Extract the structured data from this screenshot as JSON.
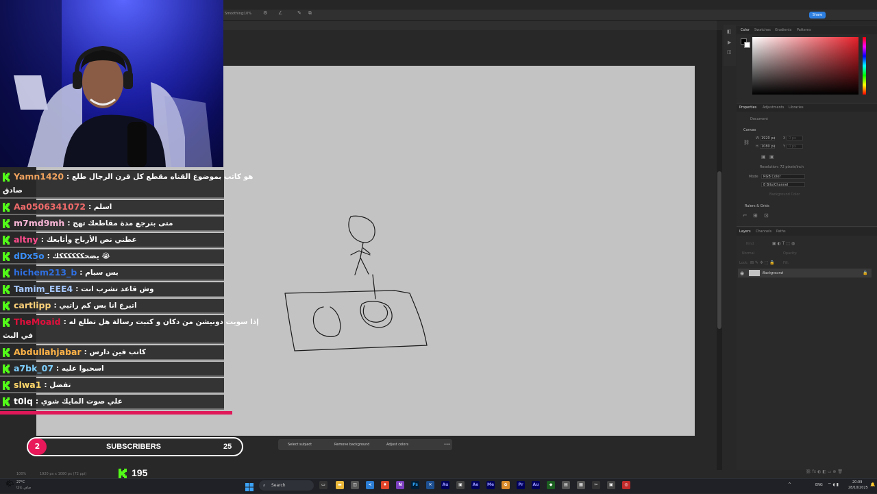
{
  "photoshop": {
    "options_bar": {
      "smoothing_label": "Smoothing:",
      "smoothing_value": "10%",
      "share_label": "Share"
    },
    "color_panel": {
      "tabs": [
        "Color",
        "Swatches",
        "Gradients",
        "Patterns"
      ]
    },
    "properties_panel": {
      "tabs": [
        "Properties",
        "Adjustments",
        "Libraries"
      ],
      "document_label": "Document",
      "canvas_label": "Canvas",
      "width_value": "1920 px",
      "height_value": "1080 px",
      "x_value": "0 px",
      "y_value": "0 px",
      "resolution": "Resolution: 72 pixels/inch",
      "mode_label": "Mode",
      "mode_value": "RGB Color",
      "bit_depth": "8 Bits/Channel",
      "fill_label": "Background Color",
      "rulers_label": "Rulers & Grids"
    },
    "layers_panel": {
      "tabs": [
        "Layers",
        "Channels",
        "Paths"
      ],
      "kind_label": "Kind",
      "blend_mode": "Normal",
      "opacity_label": "Opacity:",
      "lock_label": "Lock:",
      "fill_label": "Fill:",
      "layer_name": "Background"
    },
    "context_bar": {
      "select_subject": "Select subject",
      "remove_background": "Remove background",
      "adjust_colors": "Adjust colors"
    },
    "status": {
      "zoom": "100%",
      "doc_info": "1920 px x 1080 px (72 ppi)"
    }
  },
  "chat": {
    "accent_color": "#53fc18",
    "messages": [
      {
        "user": "Yamn1420",
        "color": "#f0a35e",
        "text": "هو كاتب بموضوع القناه مقطع كل قرن الرجال طلع :",
        "cont": "صادق"
      },
      {
        "user": "Aa0506341072",
        "color": "#f06a6a",
        "text": "اسلم :"
      },
      {
        "user": "m7md9mh",
        "color": "#f7b5d5",
        "text": "متى بترجع مدة مقاطعك تهج :"
      },
      {
        "user": "altny",
        "color": "#ff4d8d",
        "text": "عطني نص الأرباح وأتابعك :"
      },
      {
        "user": "dDx5o",
        "color": "#3a8ef7",
        "text": "😭 يضحككككككك :"
      },
      {
        "user": "hichem213_b",
        "color": "#2f6fe0",
        "text": "بس سبام :"
      },
      {
        "user": "Tamim_EEE4",
        "color": "#a6c8ff",
        "text": "وش قاعد تشرب انت :"
      },
      {
        "user": "cartlipp",
        "color": "#ffd37a",
        "text": "اتبرع انا بس كم راتبي :"
      },
      {
        "user": "TheMoaid",
        "color": "#e0103c",
        "text": "إذا سويت دونيشن من دكان و كتبت رسالة هل تطلع له :",
        "cont": "في البث"
      },
      {
        "user": "Abdullahjabar",
        "color": "#ffb347",
        "text": "كاتب فين دارس :"
      },
      {
        "user": "a7bk_07",
        "color": "#7fd0ff",
        "text": "اسحبوا عليه :"
      },
      {
        "user": "slwa1",
        "color": "#ffd86b",
        "text": "تفضل :"
      },
      {
        "user": "t0lq",
        "color": "#ffffff",
        "text": "علي صوت المايك شوي :"
      }
    ]
  },
  "subscribers": {
    "count_badge": "2",
    "label": "SUBSCRIBERS",
    "count": "25"
  },
  "kick_count": "195",
  "taskbar": {
    "search_placeholder": "Search",
    "weather_temp": "27°C",
    "weather_desc": "صافٍ غالبًا",
    "language": "ENG",
    "time": "20:09",
    "date": "28/10/2025"
  }
}
